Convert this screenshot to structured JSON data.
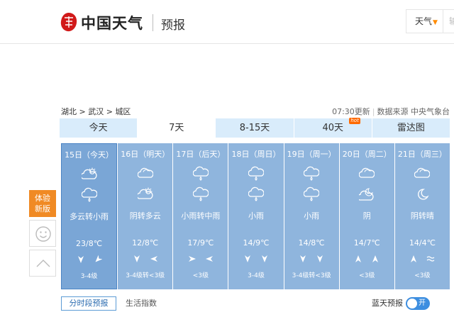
{
  "header": {
    "logo_seal_text": "天气中国",
    "logo_text": "中国天气",
    "section_title": "预报",
    "type_select": "天气",
    "search_placeholder": "输入城市、乡镇、街道、景点名称"
  },
  "breadcrumb": {
    "province": "湖北",
    "city": "武汉",
    "district": "城区",
    "separator": ">"
  },
  "update": {
    "time": "07:30更新",
    "source": "数据来源 中央气象台"
  },
  "tabs": [
    {
      "label": "今天"
    },
    {
      "label": "7天"
    },
    {
      "label": "8-15天"
    },
    {
      "label": "40天",
      "badge": "hot"
    },
    {
      "label": "雷达图"
    }
  ],
  "days": [
    {
      "name": "15日（今天）",
      "icon_day": "partly-cloudy-icon",
      "icon_night": "rain-icon",
      "desc": "多云转小雨",
      "temp": "23/8℃",
      "wind_day": "north-wind-icon",
      "wind_night": "northeast-wind-icon",
      "level": "3-4级"
    },
    {
      "name": "16日（明天）",
      "icon_day": "cloudy-icon",
      "icon_night": "partly-cloudy-icon",
      "desc": "阴转多云",
      "temp": "12/8℃",
      "wind_day": "north-wind-icon",
      "wind_night": "east-wind-icon",
      "level": "3-4级转<3级"
    },
    {
      "name": "17日（后天）",
      "icon_day": "rain-icon",
      "icon_night": "rain-icon",
      "desc": "小雨转中雨",
      "temp": "17/9℃",
      "wind_day": "west-wind-icon",
      "wind_night": "east-wind-icon",
      "level": "<3级"
    },
    {
      "name": "18日（周日）",
      "icon_day": "rain-icon",
      "icon_night": "rain-icon",
      "desc": "小雨",
      "temp": "14/9℃",
      "wind_day": "north-wind-icon",
      "wind_night": "north-wind-icon",
      "level": "3-4级"
    },
    {
      "name": "19日（周一）",
      "icon_day": "rain-icon",
      "icon_night": "rain-icon",
      "desc": "小雨",
      "temp": "14/8℃",
      "wind_day": "north-wind-icon",
      "wind_night": "north-wind-icon",
      "level": "3-4级转<3级"
    },
    {
      "name": "20日（周二）",
      "icon_day": "cloudy-icon",
      "icon_night": "cloudy-moon-icon",
      "desc": "阴",
      "temp": "14/7℃",
      "wind_day": "south-wind-icon",
      "wind_night": "south-wind-icon",
      "level": "<3级"
    },
    {
      "name": "21日（周三）",
      "icon_day": "cloudy-icon",
      "icon_night": "moon-icon",
      "desc": "阴转晴",
      "temp": "14/4℃",
      "wind_day": "south-wind-icon",
      "wind_night": "variable-wind-icon",
      "level": "<3级"
    }
  ],
  "side": {
    "experience_label": "体验新版",
    "line1": "体验",
    "line2": "新版"
  },
  "bottom": {
    "period_button": "分时段预报",
    "life_index": "生活指数",
    "blue_sky_label": "蓝天预报",
    "toggle_label": "开"
  },
  "colors": {
    "day_card": "#8fb5dd",
    "today_card": "#7aa6d6",
    "tab_bar": "#d9ecfb",
    "accent_orange": "#f08a24",
    "toggle_blue": "#3d8ee0"
  }
}
